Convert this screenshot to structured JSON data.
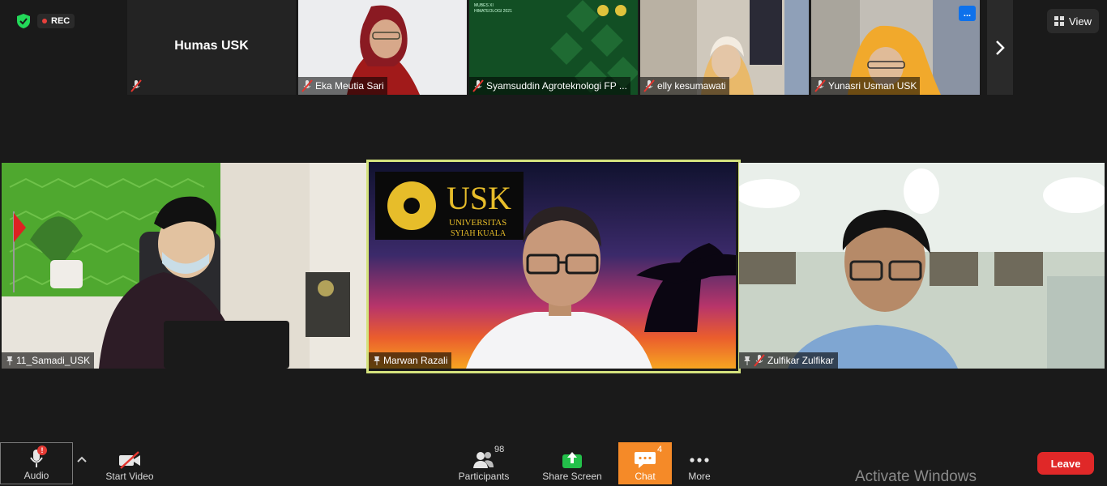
{
  "status": {
    "rec_label": "REC"
  },
  "top_strip": {
    "participants": [
      {
        "name": "Humas USK",
        "label": ""
      },
      {
        "label": "Eka Meutia Sari"
      },
      {
        "label": "Syamsuddin Agroteknologi FP ..."
      },
      {
        "label": "elly kesumawati"
      },
      {
        "label": "Yunasri Usman USK"
      }
    ],
    "more_label": "...",
    "slide_text": "MUBES XI\nHIMATEOLOGI 2021"
  },
  "view_button": {
    "label": "View"
  },
  "main_tiles": [
    {
      "name": "11_Samadi_USK"
    },
    {
      "name": "Marwan Razali",
      "logo_brand": "USK",
      "logo_line1": "UNIVERSITAS",
      "logo_line2": "SYIAH KUALA"
    },
    {
      "name": "Zulfikar Zulfikar"
    }
  ],
  "toolbar": {
    "audio": "Audio",
    "audio_alert": "!",
    "start_video": "Start Video",
    "participants": "Participants",
    "participants_count": "98",
    "share_screen": "Share Screen",
    "chat": "Chat",
    "chat_count": "4",
    "more": "More",
    "leave": "Leave"
  },
  "watermark": "Activate Windows",
  "colors": {
    "active_speaker": "#d4e27d",
    "chat_active": "#f58a28",
    "leave": "#e02828",
    "rec": "#e8403c"
  }
}
